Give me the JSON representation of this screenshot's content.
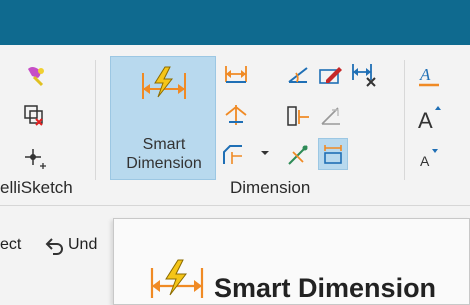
{
  "ribbon": {
    "intellisketch_group_label": "elliSketch",
    "dimension_group_label": "Dimension",
    "smart_dimension_line1": "Smart",
    "smart_dimension_line2": "Dimension"
  },
  "command_bar": {
    "select_text": "ect",
    "undo_text": "Und"
  },
  "tooltip": {
    "title": "Smart Dimension"
  },
  "colors": {
    "titlebar": "#0f6a8f",
    "accent_orange": "#f08a24",
    "highlight_blue": "#b8d9ee"
  }
}
